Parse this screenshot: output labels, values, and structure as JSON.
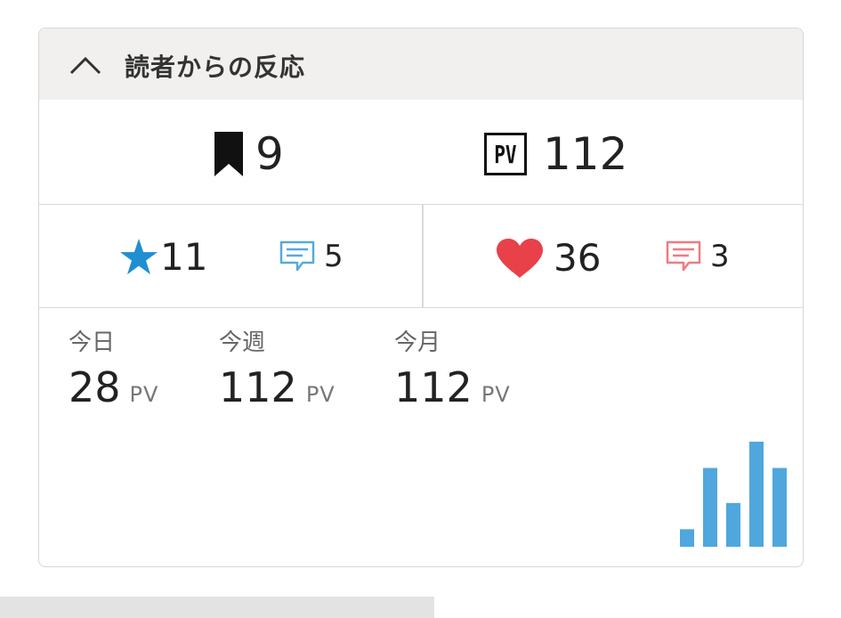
{
  "header": {
    "title": "読者からの反応",
    "collapse_icon": "chevron-up-icon"
  },
  "totals": {
    "bookmarks": {
      "icon": "bookmark-icon",
      "count": "9"
    },
    "pageviews": {
      "icon": "pv-icon",
      "icon_text": "PV",
      "count": "112"
    }
  },
  "reactions": {
    "stars": {
      "icon": "star-icon",
      "count": "11"
    },
    "hatena_comments": {
      "icon": "comment-icon",
      "count": "5"
    },
    "likes": {
      "icon": "heart-icon",
      "count": "36"
    },
    "other_comments": {
      "icon": "comment-icon",
      "count": "3"
    }
  },
  "periods": [
    {
      "label": "今日",
      "value": "28",
      "unit": "PV"
    },
    {
      "label": "今週",
      "value": "112",
      "unit": "PV"
    },
    {
      "label": "今月",
      "value": "112",
      "unit": "PV"
    }
  ],
  "colors": {
    "star_blue": "#1f8fd0",
    "comment_blue": "#57a9db",
    "heart_red": "#e8414a",
    "comment_red": "#ee7b80",
    "bar_blue": "#4fa7de",
    "header_bg": "#f1f0ee"
  },
  "chart_data": {
    "type": "bar",
    "values": [
      2,
      9,
      5,
      12,
      9
    ],
    "ylim": [
      0,
      12
    ]
  }
}
